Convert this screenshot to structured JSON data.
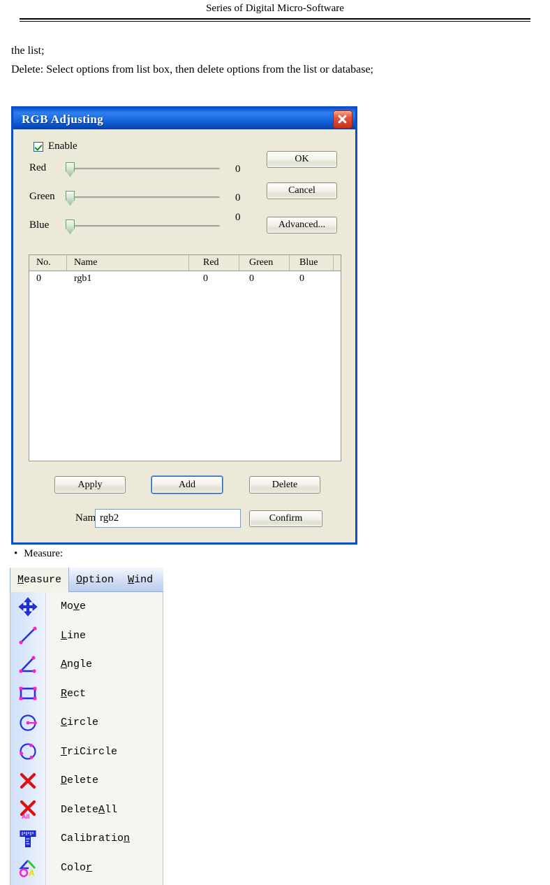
{
  "document": {
    "header_title": "Series of Digital Micro-Software",
    "lines": [
      "the list;",
      "Delete: Select options from list box, then delete options from the list or database;"
    ],
    "bullet": "Measure:"
  },
  "dialog": {
    "title": "RGB Adjusting",
    "close_icon": "close-icon",
    "enable": {
      "label": "Enable",
      "checked": true
    },
    "sliders": [
      {
        "label": "Red",
        "value": "0",
        "min": 0,
        "max": 100,
        "position": 0
      },
      {
        "label": "Green",
        "value": "0",
        "min": 0,
        "max": 100,
        "position": 0
      },
      {
        "label": "Blue",
        "value": "0",
        "min": 0,
        "max": 100,
        "position": 0
      }
    ],
    "side_buttons": {
      "ok": "OK",
      "cancel": "Cancel",
      "advanced": "Advanced..."
    },
    "list": {
      "columns": [
        "No.",
        "Name",
        "Red",
        "Green",
        "Blue"
      ],
      "rows": [
        {
          "no": "0",
          "name": "rgb1",
          "red": "0",
          "green": "0",
          "blue": "0"
        }
      ]
    },
    "action_buttons": {
      "apply": "Apply",
      "add": "Add",
      "delete": "Delete",
      "confirm": "Confirm"
    },
    "name_field": {
      "label": "Name",
      "value": "rgb2",
      "placeholder": ""
    },
    "colors": {
      "titlebar_blue": "#1668e2",
      "dialog_face": "#ece9d8",
      "close_red": "#e7533a",
      "focus_blue": "#2a63b4"
    }
  },
  "measure_menu": {
    "menubar": [
      {
        "label": "Measure",
        "mnemonic": "M",
        "rest": "easure",
        "active": true
      },
      {
        "label": "Option",
        "mnemonic": "O",
        "rest": "ption",
        "active": false
      },
      {
        "label": "Wind",
        "mnemonic": "W",
        "rest": "ind",
        "active": false
      }
    ],
    "items": [
      {
        "label": "Move",
        "pre": "Mo",
        "mnemonic": "v",
        "post": "e",
        "icon": "move-arrows-icon"
      },
      {
        "label": "Line",
        "pre": "",
        "mnemonic": "L",
        "post": "ine",
        "icon": "line-icon"
      },
      {
        "label": "Angle",
        "pre": "",
        "mnemonic": "A",
        "post": "ngle",
        "icon": "angle-icon"
      },
      {
        "label": "Rect",
        "pre": "",
        "mnemonic": "R",
        "post": "ect",
        "icon": "rectangle-icon"
      },
      {
        "label": "Circle",
        "pre": "",
        "mnemonic": "C",
        "post": "ircle",
        "icon": "circle-icon"
      },
      {
        "label": "TriCircle",
        "pre": "",
        "mnemonic": "T",
        "post": "riCircle",
        "icon": "tricircle-icon"
      },
      {
        "label": "Delete",
        "pre": "",
        "mnemonic": "D",
        "post": "elete",
        "icon": "delete-x-icon"
      },
      {
        "label": "DeleteAll",
        "pre": "Delete",
        "mnemonic": "A",
        "post": "ll",
        "icon": "delete-all-icon"
      },
      {
        "label": "Calibration",
        "pre": "Calibratio",
        "mnemonic": "n",
        "post": "",
        "icon": "calibration-ruler-icon"
      },
      {
        "label": "Color",
        "pre": "Colo",
        "mnemonic": "r",
        "post": "",
        "icon": "color-palette-icon"
      }
    ]
  }
}
